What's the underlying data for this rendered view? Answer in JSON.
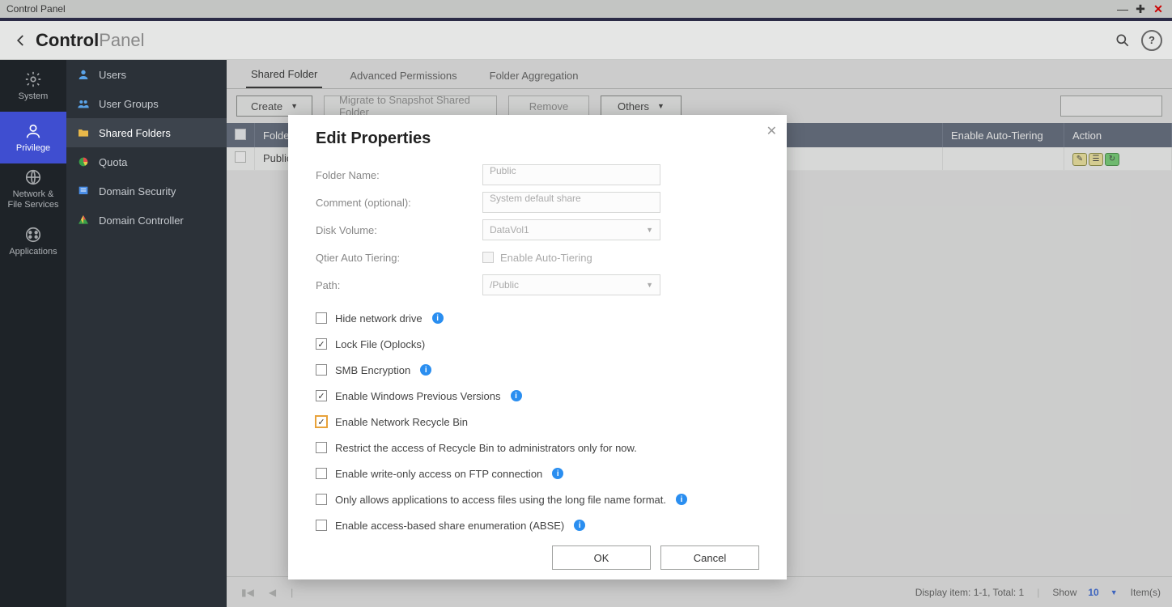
{
  "window": {
    "title": "Control Panel"
  },
  "header": {
    "brand_bold": "Control",
    "brand_light": "Panel"
  },
  "rail": [
    {
      "id": "system",
      "label": "System"
    },
    {
      "id": "privilege",
      "label": "Privilege"
    },
    {
      "id": "netfs",
      "label": "Network &\nFile Services"
    },
    {
      "id": "apps",
      "label": "Applications"
    }
  ],
  "subnav": [
    {
      "id": "users",
      "label": "Users"
    },
    {
      "id": "groups",
      "label": "User Groups"
    },
    {
      "id": "shared",
      "label": "Shared Folders"
    },
    {
      "id": "quota",
      "label": "Quota"
    },
    {
      "id": "dsec",
      "label": "Domain Security"
    },
    {
      "id": "dctrl",
      "label": "Domain Controller"
    }
  ],
  "tabs": [
    {
      "label": "Shared Folder",
      "active": true
    },
    {
      "label": "Advanced Permissions"
    },
    {
      "label": "Folder Aggregation"
    }
  ],
  "toolbar": {
    "create": "Create",
    "migrate": "Migrate to Snapshot Shared Folder",
    "remove": "Remove",
    "others": "Others"
  },
  "table": {
    "headers": {
      "folder": "Folder",
      "tier": "Enable Auto-Tiering",
      "action": "Action"
    },
    "rows": [
      {
        "folder": "Public",
        "tier": ""
      }
    ]
  },
  "footer": {
    "display": "Display item: 1-1, Total: 1",
    "show": "Show",
    "pagesize": "10",
    "items": "Item(s)"
  },
  "modal": {
    "title": "Edit Properties",
    "labels": {
      "folder": "Folder Name:",
      "comment": "Comment (optional):",
      "volume": "Disk Volume:",
      "qtier": "Qtier Auto Tiering:",
      "qtier_chk": "Enable Auto-Tiering",
      "path": "Path:"
    },
    "values": {
      "folder": "Public",
      "comment": "System default share",
      "volume": "DataVol1",
      "path": "/Public"
    },
    "checks": [
      {
        "id": "hide",
        "label": "Hide network drive",
        "checked": false,
        "info": true
      },
      {
        "id": "lock",
        "label": "Lock File (Oplocks)",
        "checked": true,
        "info": false
      },
      {
        "id": "smb",
        "label": "SMB Encryption",
        "checked": false,
        "info": true
      },
      {
        "id": "prev",
        "label": "Enable Windows Previous Versions",
        "checked": true,
        "info": true
      },
      {
        "id": "recycle",
        "label": "Enable Network Recycle Bin",
        "checked": true,
        "info": false,
        "focus": true
      },
      {
        "id": "restrict",
        "label": "Restrict the access of Recycle Bin to administrators only for now.",
        "checked": false,
        "info": false
      },
      {
        "id": "ftpwo",
        "label": "Enable write-only access on FTP connection",
        "checked": false,
        "info": true
      },
      {
        "id": "longfn",
        "label": "Only allows applications to access files using the long file name format.",
        "checked": false,
        "info": true
      },
      {
        "id": "abse",
        "label": "Enable access-based share enumeration (ABSE)",
        "checked": false,
        "info": true
      }
    ],
    "buttons": {
      "ok": "OK",
      "cancel": "Cancel"
    }
  }
}
